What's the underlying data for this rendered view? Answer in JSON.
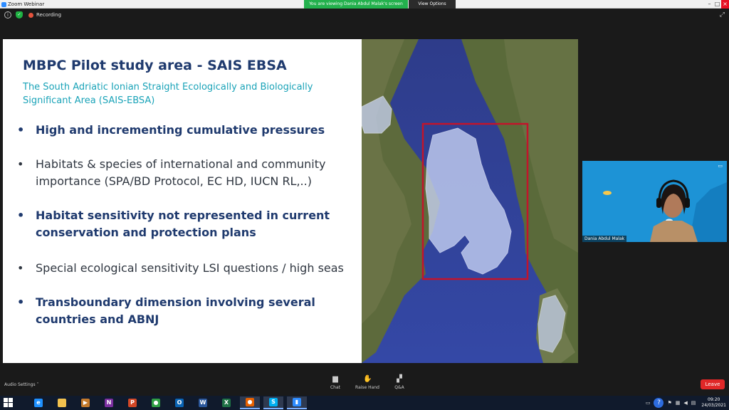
{
  "window": {
    "title": "Zoom Webinar",
    "share_banner": "You are viewing Dania Abdul Malak's screen",
    "view_options": "View Options",
    "bg_tabs": [
      "",
      "",
      "",
      ""
    ]
  },
  "meeting": {
    "recording_label": "Recording"
  },
  "slide": {
    "title": "MBPC Pilot study area  - SAIS EBSA",
    "subtitle": "The South Adriatic Ionian Straight Ecologically and Biologically Significant Area (SAIS-EBSA)",
    "bullets": [
      {
        "text": "High and incrementing cumulative pressures",
        "bold": true
      },
      {
        "text": "Habitats & species of international and community importance (SPA/BD Protocol, EC HD, IUCN RL,..)",
        "bold": false
      },
      {
        "text": "Habitat sensitivity not represented in current conservation and protection plans",
        "bold": true
      },
      {
        "text": "Special ecological sensitivity LSI questions / high seas",
        "bold": false
      },
      {
        "text": "Transboundary dimension involving several countries and ABNJ",
        "bold": true
      }
    ]
  },
  "video": {
    "participant_name": "Dania Abdul Malak"
  },
  "controls": {
    "audio_settings": "Audio Settings",
    "chat": "Chat",
    "raise_hand": "Raise Hand",
    "qa": "Q&A",
    "leave": "Leave"
  },
  "taskbar": {
    "apps": [
      {
        "name": "ie",
        "color": "#1e90ff",
        "glyph": "e"
      },
      {
        "name": "file-explorer",
        "color": "#f2c14e",
        "glyph": ""
      },
      {
        "name": "media",
        "color": "#c47a2c",
        "glyph": "▶"
      },
      {
        "name": "onenote",
        "color": "#7b2fa0",
        "glyph": "N"
      },
      {
        "name": "powerpoint",
        "color": "#d24726",
        "glyph": "P"
      },
      {
        "name": "chrome",
        "color": "#2f9e44",
        "glyph": "●"
      },
      {
        "name": "outlook",
        "color": "#0a64b4",
        "glyph": "O"
      },
      {
        "name": "word",
        "color": "#2b579a",
        "glyph": "W"
      },
      {
        "name": "excel",
        "color": "#1e7145",
        "glyph": "X"
      },
      {
        "name": "firefox",
        "color": "#e66000",
        "glyph": "●"
      },
      {
        "name": "skype",
        "color": "#00aff0",
        "glyph": "S"
      },
      {
        "name": "zoom",
        "color": "#2d8cff",
        "glyph": "▮"
      }
    ],
    "time": "09:20",
    "date": "24/03/2021"
  }
}
